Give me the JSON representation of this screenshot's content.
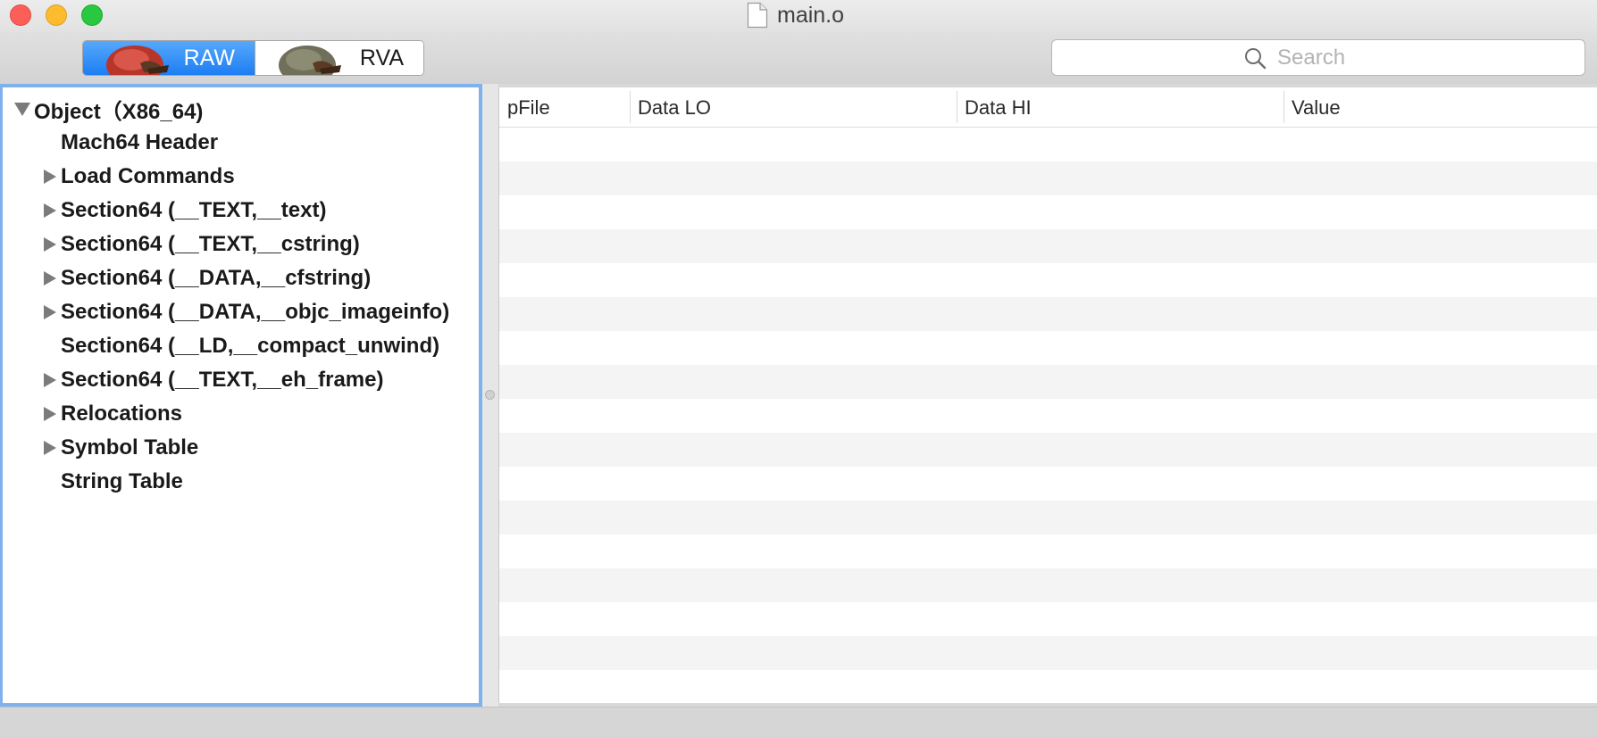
{
  "window": {
    "title": "main.o"
  },
  "toolbar": {
    "mode_raw": "RAW",
    "mode_rva": "RVA",
    "selected_mode": "RAW",
    "search_placeholder": "Search",
    "search_value": ""
  },
  "outline": {
    "items": [
      {
        "label": "Object（X86_64)",
        "level": 0,
        "disclosure": "expanded"
      },
      {
        "label": "Mach64 Header",
        "level": 1,
        "disclosure": "none"
      },
      {
        "label": "Load Commands",
        "level": 1,
        "disclosure": "collapsed"
      },
      {
        "label": "Section64 (__TEXT,__text)",
        "level": 1,
        "disclosure": "collapsed"
      },
      {
        "label": "Section64 (__TEXT,__cstring)",
        "level": 1,
        "disclosure": "collapsed"
      },
      {
        "label": "Section64 (__DATA,__cfstring)",
        "level": 1,
        "disclosure": "collapsed"
      },
      {
        "label": "Section64 (__DATA,__objc_imageinfo)",
        "level": 1,
        "disclosure": "collapsed"
      },
      {
        "label": "Section64 (__LD,__compact_unwind)",
        "level": 1,
        "disclosure": "none"
      },
      {
        "label": "Section64 (__TEXT,__eh_frame)",
        "level": 1,
        "disclosure": "collapsed"
      },
      {
        "label": "Relocations",
        "level": 1,
        "disclosure": "collapsed"
      },
      {
        "label": "Symbol Table",
        "level": 1,
        "disclosure": "collapsed"
      },
      {
        "label": "String Table",
        "level": 1,
        "disclosure": "none"
      }
    ]
  },
  "table": {
    "columns": [
      "pFile",
      "Data LO",
      "Data HI",
      "Value"
    ],
    "rows": []
  },
  "colors": {
    "accent": "#1d7ef3",
    "selection_border": "#7fb2ec",
    "row_stripe": "#f4f4f4"
  },
  "icons": [
    "document-icon",
    "search-icon",
    "raw-mode-image",
    "rva-mode-image",
    "disclosure-triangle-icon"
  ]
}
